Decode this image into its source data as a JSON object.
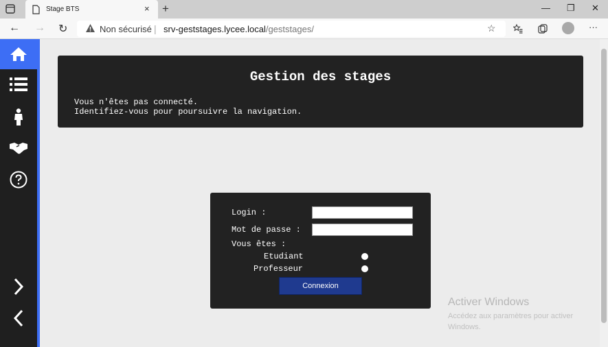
{
  "browser": {
    "tab_title": "Stage BTS",
    "tab_close": "×",
    "new_tab": "+",
    "security_label": "Non sécurisé",
    "url_separator": "|",
    "url_host": "srv-geststages.lycee.local",
    "url_path": "/geststages/",
    "window_controls": {
      "minimize": "—",
      "restore": "❐",
      "close": "✕"
    },
    "nav": {
      "back": "←",
      "forward": "→",
      "refresh": "↻",
      "more": "···"
    }
  },
  "sidebar": {
    "items": [
      {
        "name": "home",
        "icon": "home-icon",
        "active": true
      },
      {
        "name": "list",
        "icon": "list-icon"
      },
      {
        "name": "student",
        "icon": "person-icon"
      },
      {
        "name": "companies",
        "icon": "handshake-icon"
      },
      {
        "name": "help",
        "icon": "question-icon"
      },
      {
        "name": "next",
        "icon": "chevron-right-icon"
      },
      {
        "name": "previous",
        "icon": "chevron-left-icon"
      }
    ],
    "accent": "#3d6ef5"
  },
  "header": {
    "title": "Gestion des stages",
    "message_line1": "Vous n'êtes pas connecté.",
    "message_line2": "Identifiez-vous pour poursuivre la navigation."
  },
  "login": {
    "login_label": "Login :",
    "login_value": "",
    "password_label": "Mot de passe :",
    "password_value": "",
    "role_label": "Vous êtes :",
    "roles": [
      {
        "label": "Etudiant",
        "selected": false
      },
      {
        "label": "Professeur",
        "selected": false
      }
    ],
    "submit_label": "Connexion"
  },
  "watermark": {
    "title": "Activer Windows",
    "subtitle": "Accédez aux paramètres pour activer Windows."
  }
}
